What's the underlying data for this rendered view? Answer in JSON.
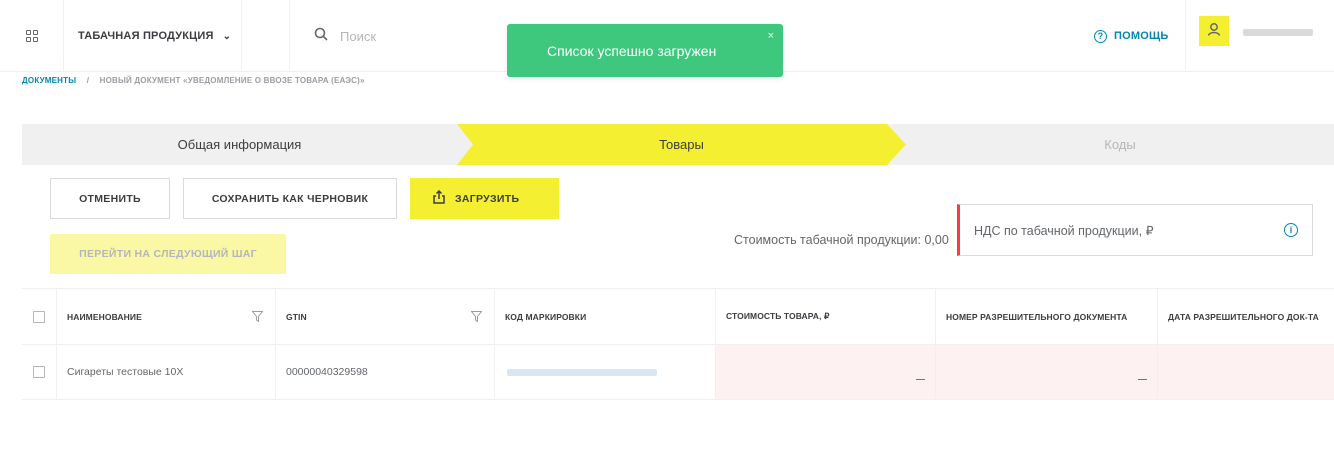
{
  "topbar": {
    "product_label": "ТАБАЧНАЯ ПРОДУКЦИЯ",
    "product_chevron": "⌄",
    "search_placeholder": "Поиск",
    "help_label": "ПОМОЩЬ"
  },
  "toast": {
    "message": "Список успешно загружен",
    "close": "×"
  },
  "breadcrumb": {
    "root": "ДОКУМЕНТЫ",
    "separator": "/",
    "current": "НОВЫЙ ДОКУМЕНТ «УВЕДОМЛЕНИЕ О ВВОЗЕ ТОВАРА (ЕАЭС)»"
  },
  "steps": [
    {
      "label": "Общая информация",
      "state": "done"
    },
    {
      "label": "Товары",
      "state": "active"
    },
    {
      "label": "Коды",
      "state": "pending"
    }
  ],
  "actions": {
    "cancel": "ОТМЕНИТЬ",
    "save_draft": "СОХРАНИТЬ КАК ЧЕРНОВИК",
    "upload": "ЗАГРУЗИТЬ",
    "next_step": "ПЕРЕЙТИ НА СЛЕДУЮЩИЙ ШАГ"
  },
  "summary": {
    "cost_text": "Стоимость табачной продукции: 0,00",
    "vat_placeholder": "НДС по табачной продукции, ₽"
  },
  "table": {
    "headers": [
      "НАИМЕНОВАНИЕ",
      "GTIN",
      "КОД МАРКИРОВКИ",
      "СТОИМОСТЬ ТОВАРА, ₽",
      "НОМЕР РАЗРЕШИТЕЛЬНОГО ДОКУМЕНТА",
      "ДАТА РАЗРЕШИТЕЛЬНОГО ДОК-ТА"
    ],
    "rows": [
      {
        "name": "Сигареты тестовые 10X",
        "gtin": "00000040329598"
      }
    ]
  },
  "colors": {
    "accent_yellow": "#f5ef31",
    "link_blue": "#0287b0",
    "toast_green": "#3ec87e",
    "error_red": "#ff3a3a"
  },
  "icons": [
    "apps-grid-icon",
    "chevron-down-icon",
    "search-icon",
    "help-circle-icon",
    "user-icon",
    "close-icon",
    "upload-icon",
    "info-icon",
    "filter-icon"
  ]
}
